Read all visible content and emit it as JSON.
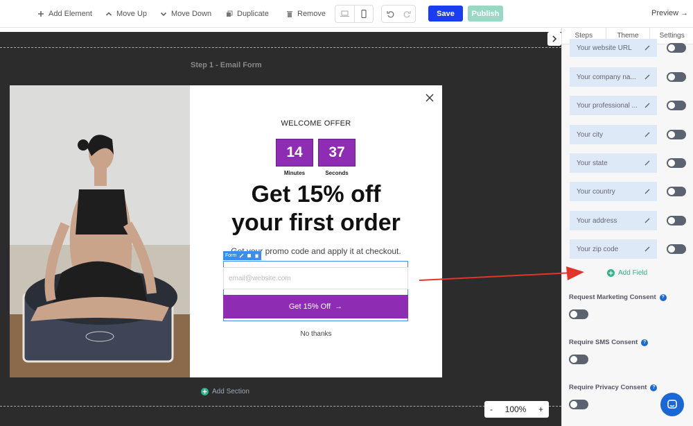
{
  "toolbar": {
    "add_element": "Add Element",
    "move_up": "Move Up",
    "move_down": "Move Down",
    "duplicate": "Duplicate",
    "remove": "Remove",
    "save": "Save",
    "publish": "Publish",
    "preview": "Preview →"
  },
  "canvas": {
    "step_label": "Step 1 - Email Form",
    "add_section": "Add Section",
    "zoom_minus": "-",
    "zoom_level": "100%",
    "zoom_plus": "+"
  },
  "popup": {
    "offer_title": "WELCOME OFFER",
    "timer_minutes": "14",
    "timer_seconds": "37",
    "minutes_label": "Minutes",
    "seconds_label": "Seconds",
    "headline_line1": "Get 15% off",
    "headline_line2": "your first order",
    "subline": "Get your promo code and apply it at checkout.",
    "form_tag": "Form",
    "email_placeholder": "email@website.com",
    "cta_label": "Get 15% Off",
    "cta_arrow": "→",
    "no_thanks": "No thanks",
    "accent_color": "#8e2db4"
  },
  "panel": {
    "tabs": [
      "Steps",
      "Theme",
      "Settings"
    ],
    "fields": [
      {
        "label": "Your website URL"
      },
      {
        "label": "Your company na..."
      },
      {
        "label": "Your professional ..."
      },
      {
        "label": "Your city"
      },
      {
        "label": "Your state"
      },
      {
        "label": "Your country"
      },
      {
        "label": "Your address"
      },
      {
        "label": "Your zip code"
      }
    ],
    "add_field": "Add Field",
    "consents": [
      {
        "label": "Request Marketing Consent"
      },
      {
        "label": "Require SMS Consent"
      },
      {
        "label": "Require Privacy Consent"
      }
    ]
  }
}
